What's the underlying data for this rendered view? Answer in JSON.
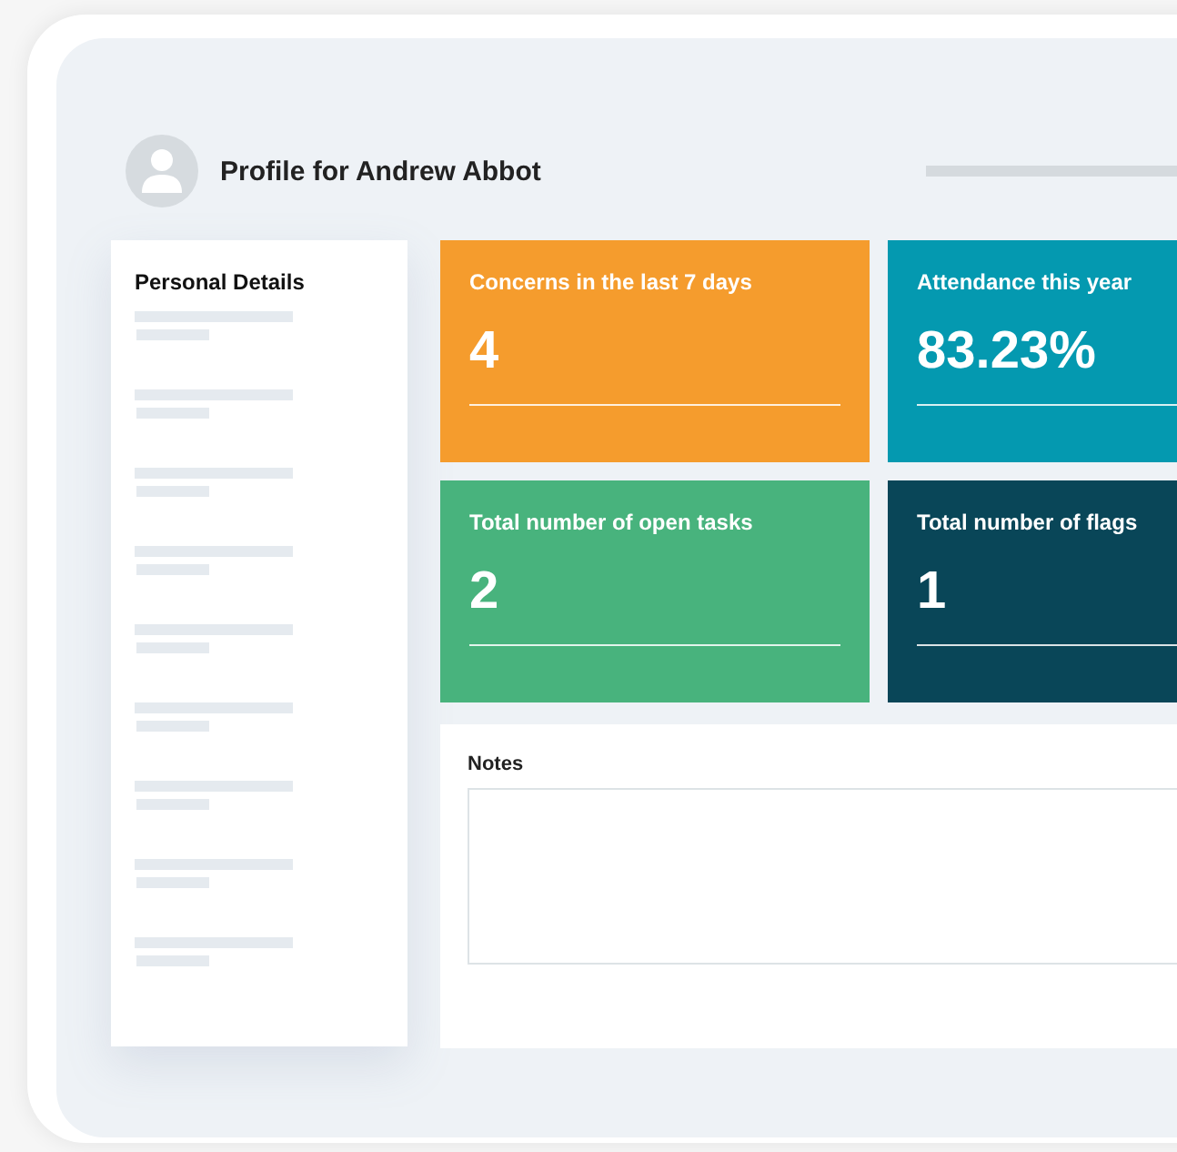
{
  "header": {
    "title": "Profile for Andrew Abbot"
  },
  "sidebar": {
    "title": "Personal Details"
  },
  "cards": [
    {
      "title": "Concerns in the last 7 days",
      "value": "4",
      "color": "#f59c2d"
    },
    {
      "title": "Attendance this year",
      "value": "83.23%",
      "color": "#0499b0"
    },
    {
      "title": "Total number of open tasks",
      "value": "2",
      "color": "#48b37d"
    },
    {
      "title": "Total number of flags",
      "value": "1",
      "color": "#094658"
    }
  ],
  "notes": {
    "label": "Notes"
  }
}
